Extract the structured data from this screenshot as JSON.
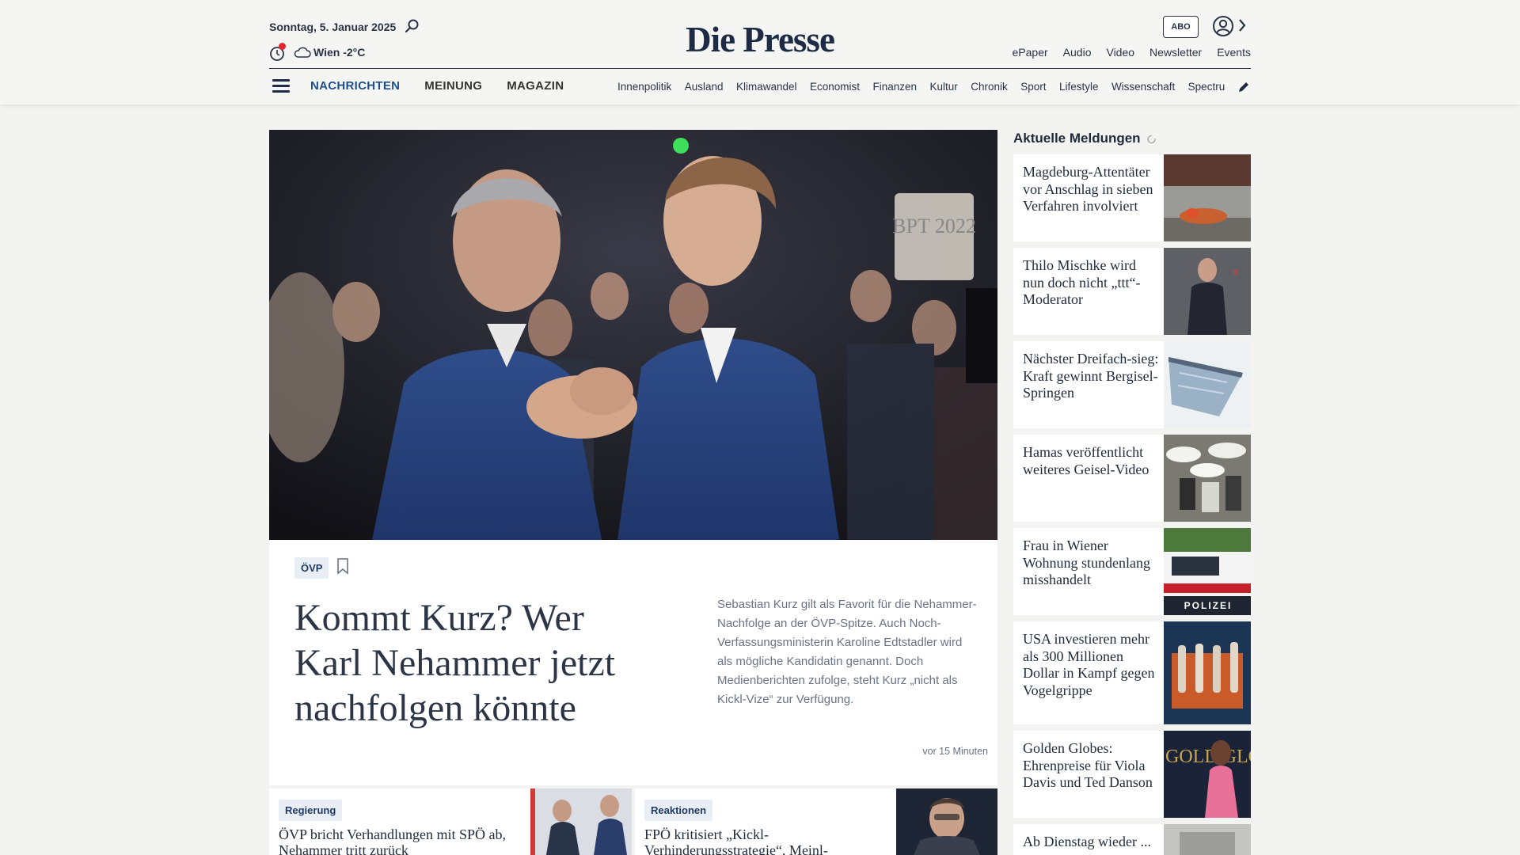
{
  "header": {
    "date": "Sonntag, 5. Januar 2025",
    "weather": "Wien -2°C",
    "logo": "Die Presse",
    "abo_label": "ABO",
    "top_links": [
      "ePaper",
      "Audio",
      "Video",
      "Newsletter",
      "Events"
    ],
    "main_nav": [
      "NACHRICHTEN",
      "MEINUNG",
      "MAGAZIN"
    ],
    "sub_nav": [
      "Innenpolitik",
      "Ausland",
      "Klimawandel",
      "Economist",
      "Finanzen",
      "Kultur",
      "Chronik",
      "Sport",
      "Lifestyle",
      "Wissenschaft",
      "Spectrum"
    ],
    "accent_color": "#1e4f8c",
    "alert_color": "#e3262f"
  },
  "hero": {
    "tag": "ÖVP",
    "title": "Kommt Kurz? Wer Karl Nehammer jetzt nachfolgen könnte",
    "lead": "Sebastian Kurz gilt als Favorit für die Nehammer-Nachfolge an der ÖVP-Spitze. Auch Noch-Verfassungsministerin Karoline Edtstadler wird als mögliche Kandidatin genannt. Doch Medienberichten zufolge, steht Kurz „nicht als Kickl-Vize“ zur Verfügung.",
    "time": "vor 15 Minuten",
    "image_sign": "BPT 2022"
  },
  "cards": [
    {
      "tag": "Regierung",
      "title": "ÖVP bricht Verhandlungen mit SPÖ ab, Nehammer tritt zurück"
    },
    {
      "tag": "Reaktionen",
      "title": "FPÖ kritisiert „Kickl-Verhinderungsstrategie“, Meinl-Reisinger"
    }
  ],
  "sidebar": {
    "title": "Aktuelle Meldungen",
    "items": [
      {
        "title": "Magdeburg-Attentäter vor Anschlag in sieben Verfahren involviert"
      },
      {
        "title": "Thilo Mischke wird nun doch nicht „ttt“-Moderator"
      },
      {
        "title": "Nächster Dreifach-sieg: Kraft gewinnt Bergisel-Springen"
      },
      {
        "title": "Hamas veröffentlicht weiteres Geisel-Video"
      },
      {
        "title": "Frau in Wiener Wohnung stundenlang misshandelt",
        "image_text": "POLIZEI"
      },
      {
        "title": "USA investieren mehr als 300 Millionen Dollar in Kampf gegen Vogelgrippe"
      },
      {
        "title": "Golden Globes: Ehrenpreise für Viola Davis und Ted Danson",
        "image_text": "GOLD GLO"
      },
      {
        "title": "Ab Dienstag wieder ..."
      }
    ]
  }
}
